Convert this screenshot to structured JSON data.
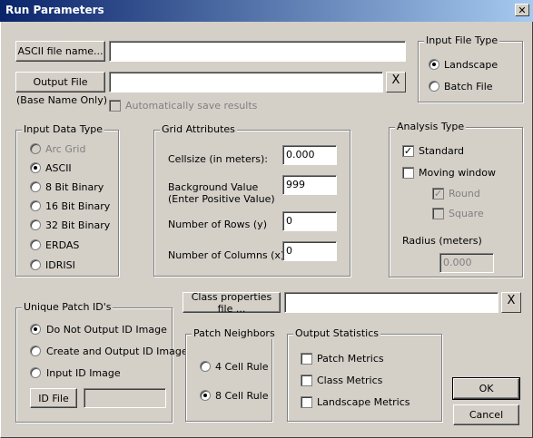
{
  "window": {
    "title": "Run Parameters",
    "close_glyph": "✕"
  },
  "files": {
    "ascii_button": "ASCII file name...",
    "ascii_value": "",
    "output_button": "Output File",
    "output_value": "",
    "output_clear": "X",
    "base_name_note": "(Base Name Only)",
    "auto_save_label": "Automatically save results"
  },
  "input_file_type": {
    "title": "Input File Type",
    "options": [
      "Landscape",
      "Batch File"
    ],
    "selected": "Landscape"
  },
  "input_data_type": {
    "title": "Input Data Type",
    "options": [
      "Arc Grid",
      "ASCII",
      "8 Bit Binary",
      "16 Bit Binary",
      "32 Bit Binary",
      "ERDAS",
      "IDRISI"
    ],
    "selected": "ASCII"
  },
  "grid_attributes": {
    "title": "Grid Attributes",
    "cellsize_label": "Cellsize (in meters):",
    "cellsize_value": "0.000",
    "background_label_1": "Background Value",
    "background_label_2": "(Enter Positive Value)",
    "background_value": "999",
    "rows_label": "Number of Rows (y)",
    "rows_value": "0",
    "cols_label": "Number of Columns (x)",
    "cols_value": "0"
  },
  "analysis_type": {
    "title": "Analysis Type",
    "standard_label": "Standard",
    "standard_checked": true,
    "moving_label": "Moving window",
    "moving_checked": false,
    "round_label": "Round",
    "round_checked": true,
    "square_label": "Square",
    "square_checked": false,
    "radius_label": "Radius (meters)",
    "radius_value": "0.000"
  },
  "unique_patch": {
    "title": "Unique Patch ID's",
    "options": [
      "Do Not Output ID Image",
      "Create and Output ID Image",
      "Input ID Image"
    ],
    "selected": "Do Not Output ID Image",
    "id_file_button": "ID File",
    "id_file_value": ""
  },
  "class_properties": {
    "button": "Class properties file ...",
    "value": "",
    "clear": "X"
  },
  "patch_neighbors": {
    "title": "Patch Neighbors",
    "options": [
      "4 Cell Rule",
      "8 Cell Rule"
    ],
    "selected": "8 Cell Rule"
  },
  "output_statistics": {
    "title": "Output Statistics",
    "options": [
      "Patch Metrics",
      "Class Metrics",
      "Landscape Metrics"
    ]
  },
  "actions": {
    "ok": "OK",
    "cancel": "Cancel"
  }
}
